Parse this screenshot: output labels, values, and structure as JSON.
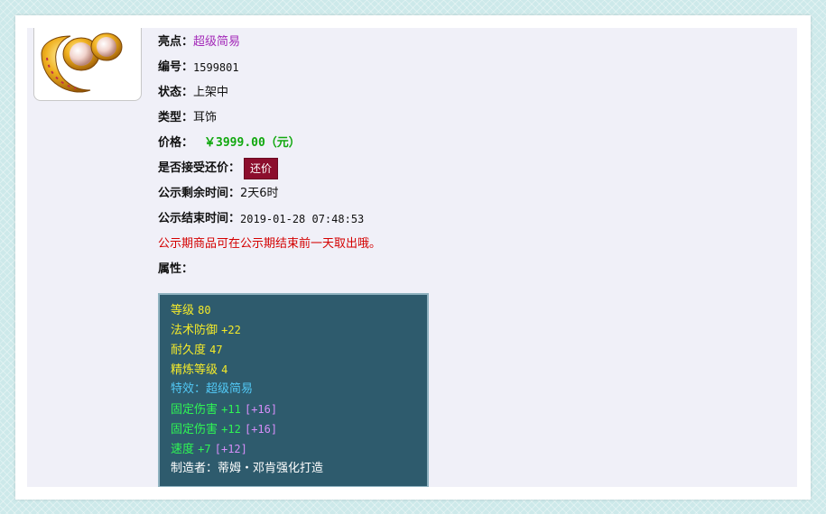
{
  "item": {
    "highlight_label": "亮点：",
    "highlight_value": "超级简易",
    "id_label": "编号：",
    "id_value": "1599801",
    "status_label": "状态：",
    "status_value": "上架中",
    "type_label": "类型：",
    "type_value": "耳饰",
    "price_label": "价格：",
    "price_value": "￥3999.00（元）",
    "counteroffer_label": "是否接受还价：",
    "counteroffer_button": "还价",
    "remaining_label": "公示剩余时间：",
    "remaining_value": "2天6时",
    "end_label": "公示结束时间：",
    "end_value": "2019-01-28 07:48:53",
    "notice": "公示期商品可在公示期结束前一天取出哦。",
    "attributes_label": "属性："
  },
  "attributes": {
    "level_label": "等级",
    "level_value": "80",
    "magic_def_label": "法术防御",
    "magic_def_value": "+22",
    "durability_label": "耐久度",
    "durability_value": "47",
    "refine_label": "精炼等级",
    "refine_value": "4",
    "effect_label": "特效：",
    "effect_value": "超级简易",
    "fixed_dmg_1_label": "固定伤害",
    "fixed_dmg_1_value": "+11",
    "fixed_dmg_1_bonus": "[+16]",
    "fixed_dmg_2_label": "固定伤害",
    "fixed_dmg_2_value": "+12",
    "fixed_dmg_2_bonus": "[+16]",
    "speed_label": "速度",
    "speed_value": "+7",
    "speed_bonus": "[+12]",
    "maker": "制造者：蒂姆・邓肯强化打造"
  },
  "colors": {
    "price": "#11a80f",
    "highlight": "#a329b8",
    "notice": "#d40000",
    "button_bg": "#8c0e2d",
    "attr_panel_bg": "#2e5b6d",
    "attr_yellow": "#f4ea2a",
    "attr_blue": "#52c8f5",
    "attr_green": "#2ff554",
    "attr_purple": "#d68ef9"
  },
  "icons": {
    "item_image": "pearl-earring-icon"
  }
}
